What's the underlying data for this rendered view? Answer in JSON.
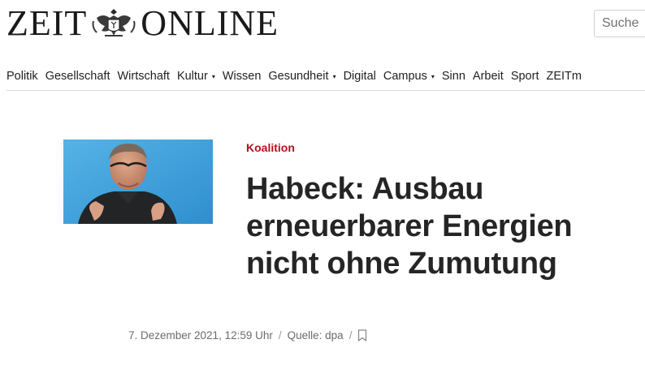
{
  "brand": {
    "logo_left": "ZEIT",
    "logo_right": "ONLINE",
    "emblem_icon": "eagle-crest-icon"
  },
  "search": {
    "placeholder": "Suche",
    "icon": "search-field"
  },
  "nav": {
    "items": [
      {
        "label": "Politik",
        "dropdown": false
      },
      {
        "label": "Gesellschaft",
        "dropdown": false
      },
      {
        "label": "Wirtschaft",
        "dropdown": false
      },
      {
        "label": "Kultur",
        "dropdown": true
      },
      {
        "label": "Wissen",
        "dropdown": false
      },
      {
        "label": "Gesundheit",
        "dropdown": true
      },
      {
        "label": "Digital",
        "dropdown": false
      },
      {
        "label": "Campus",
        "dropdown": true
      },
      {
        "label": "Sinn",
        "dropdown": false
      },
      {
        "label": "Arbeit",
        "dropdown": false
      },
      {
        "label": "Sport",
        "dropdown": false
      },
      {
        "label": "ZEITm",
        "dropdown": false
      }
    ],
    "caret": "▾"
  },
  "article": {
    "kicker": "Koalition",
    "headline_lines": [
      "Habeck: Ausbau",
      "erneuerbarer Energien",
      "nicht ohne Zumutung"
    ],
    "date": "7. Dezember 2021, 12:59 Uhr",
    "separator": "/",
    "source": "Quelle: dpa",
    "bookmark_icon": "bookmark-icon"
  },
  "colors": {
    "kicker": "#b5101b",
    "text": "#252525",
    "meta": "#6b6b6b",
    "image_bg": "#3f9fd8"
  }
}
